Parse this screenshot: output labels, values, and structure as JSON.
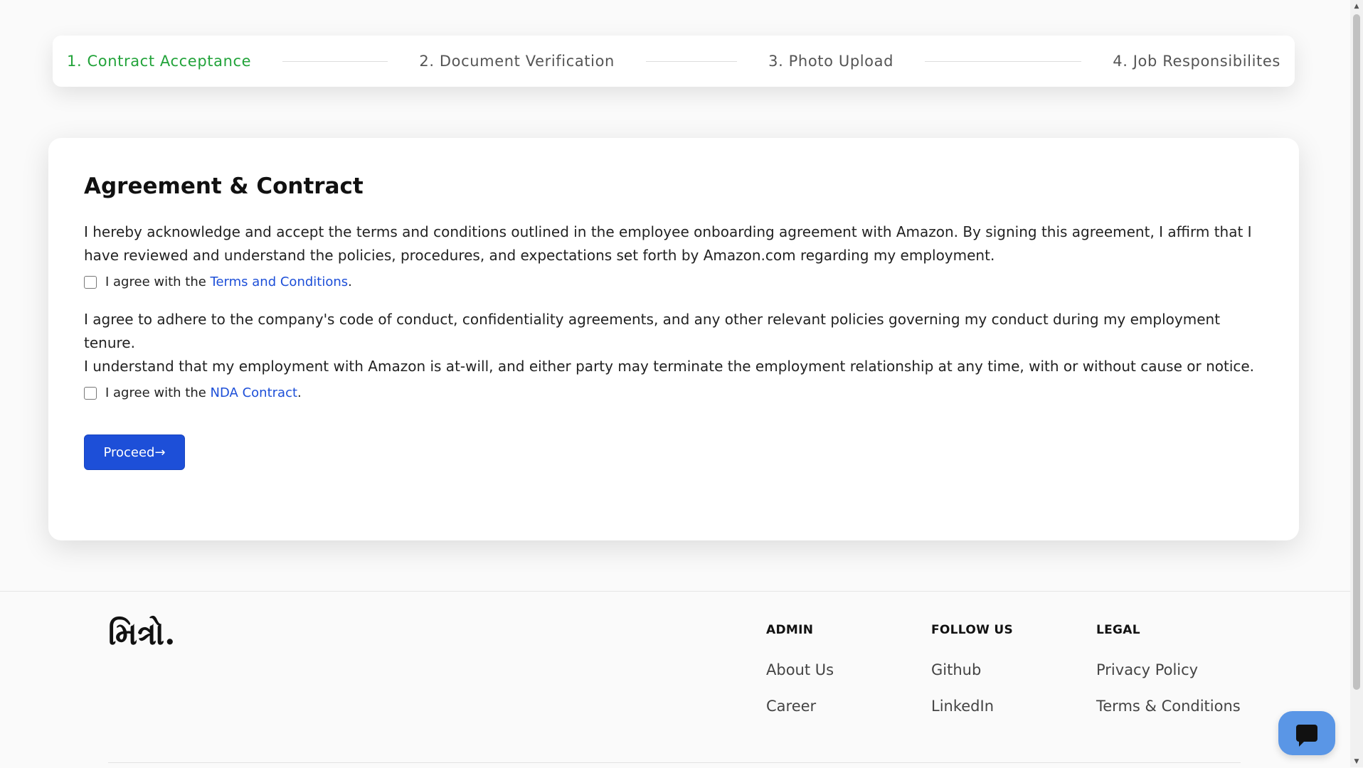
{
  "stepper": {
    "steps": [
      {
        "label": "1.  Contract  Acceptance",
        "active": true
      },
      {
        "label": "2.  Document  Verification",
        "active": false
      },
      {
        "label": "3.  Photo  Upload",
        "active": false
      },
      {
        "label": "4.  Job  Responsibilites",
        "active": false
      }
    ]
  },
  "card": {
    "title": "Agreement & Contract",
    "paragraph1": "I hereby acknowledge and accept the terms and conditions outlined in the employee onboarding agreement with Amazon. By signing this agreement, I affirm that I have reviewed and understand the policies, procedures, and expectations set forth by Amazon.com regarding my employment.",
    "check1_prefix": "I agree with the ",
    "check1_link": "Terms and Conditions",
    "check1_suffix": ".",
    "paragraph2": "I agree to adhere to the company's code of conduct, confidentiality agreements, and any other relevant policies governing my conduct during my employment tenure.",
    "paragraph3": "I understand that my employment with Amazon is at-will, and either party may terminate the employment relationship at any time, with or without cause or notice.",
    "check2_prefix": "I agree with the ",
    "check2_link": "NDA Contract",
    "check2_suffix": ".",
    "proceed_label": "Proceed→"
  },
  "footer": {
    "logo": "મિત્રો.",
    "columns": [
      {
        "heading": "ADMIN",
        "links": [
          "About Us",
          "Career"
        ]
      },
      {
        "heading": "FOLLOW US",
        "links": [
          "Github",
          "LinkedIn"
        ]
      },
      {
        "heading": "LEGAL",
        "links": [
          "Privacy Policy",
          "Terms & Conditions"
        ]
      }
    ]
  },
  "colors": {
    "accent": "#1d4fd8",
    "active_step": "#22a33a",
    "chat_button": "#5a96e6"
  },
  "icons": {
    "chat": "chat-bubble-icon",
    "scroll_up": "scroll-up-arrow-icon",
    "scroll_down": "scroll-down-arrow-icon"
  }
}
